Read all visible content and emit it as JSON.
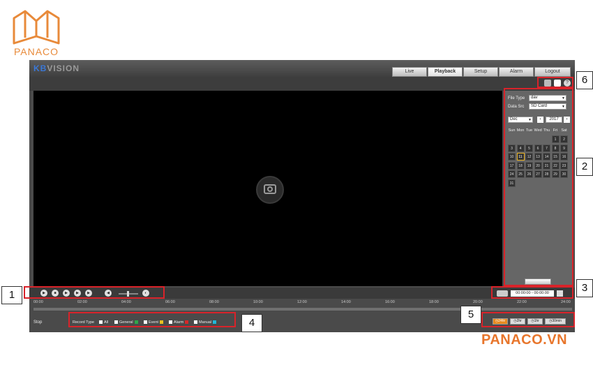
{
  "watermark": {
    "logo_text": "PANACO",
    "site_url": "PANACO.VN"
  },
  "app": {
    "brand_accent": "KB",
    "brand_rest": "VISION",
    "tabs": [
      {
        "label": "Live",
        "active": false
      },
      {
        "label": "Playback",
        "active": true
      },
      {
        "label": "Setup",
        "active": false
      },
      {
        "label": "Alarm",
        "active": false
      },
      {
        "label": "Logout",
        "active": false
      }
    ]
  },
  "side_panel": {
    "file_type_label": "File Type",
    "file_type_value": "dav",
    "data_src_label": "Data Src",
    "data_src_value": "SD Card",
    "month_value": "Dec",
    "year_value": "2017",
    "prev_icon": "chevron-left-icon",
    "next_icon": "chevron-right-icon",
    "weekdays": [
      "Sun",
      "Mon",
      "Tue",
      "Wed",
      "Thu",
      "Fri",
      "Sat"
    ],
    "days": [
      "1",
      "2",
      "3",
      "4",
      "5",
      "6",
      "7",
      "8",
      "9",
      "10",
      "11",
      "12",
      "13",
      "14",
      "15",
      "16",
      "17",
      "18",
      "19",
      "20",
      "21",
      "22",
      "23",
      "24",
      "25",
      "26",
      "27",
      "28",
      "29",
      "30",
      "31"
    ],
    "selected_day": "11",
    "first_weekday": 5
  },
  "controls": {
    "buttons": [
      "play-icon",
      "stop-icon",
      "next-frame-icon",
      "slow-icon",
      "fast-icon"
    ],
    "time_range": "00:00:00 - 00:00:00"
  },
  "timeline": {
    "ticks": [
      "00:00",
      "02:00",
      "04:00",
      "06:00",
      "08:00",
      "10:00",
      "12:00",
      "14:00",
      "16:00",
      "18:00",
      "20:00",
      "22:00",
      "24:00"
    ]
  },
  "bottom": {
    "stop_label": "Stop",
    "record_type_label": "Record Type",
    "record_types": [
      {
        "label": "All",
        "color": ""
      },
      {
        "label": "General",
        "color": "#2ea84a"
      },
      {
        "label": "Event",
        "color": "#e8c020"
      },
      {
        "label": "Alarm",
        "color": "#d62828"
      },
      {
        "label": "Manual",
        "color": "#20b8d8"
      }
    ],
    "zoom_buttons": [
      {
        "label": "24hr",
        "active": true
      },
      {
        "label": "2hr",
        "active": false
      },
      {
        "label": "1hr",
        "active": false
      },
      {
        "label": "30min",
        "active": false
      }
    ]
  },
  "callouts": [
    "1",
    "2",
    "3",
    "4",
    "5",
    "6"
  ],
  "colors": {
    "accent": "#e88a1e",
    "annotation_red": "#d9232a",
    "watermark_orange": "#e8762c"
  }
}
